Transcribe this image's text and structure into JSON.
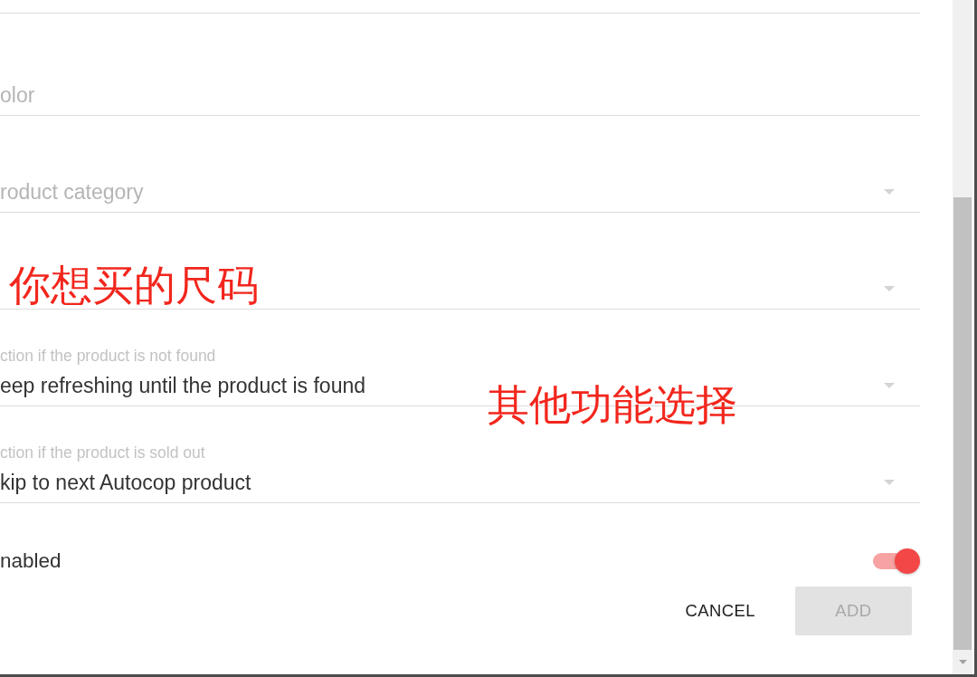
{
  "form": {
    "fields": [
      {
        "kind": "text"
      },
      {
        "kind": "text",
        "placeholder": "olor"
      },
      {
        "kind": "select",
        "placeholder": "roduct category"
      },
      {
        "kind": "select"
      },
      {
        "kind": "select",
        "label": "ction if the product is not found",
        "value": "eep refreshing until the product is found"
      },
      {
        "kind": "select",
        "label": "ction if the product is sold out",
        "value": "kip to next Autocop product"
      }
    ],
    "toggle": {
      "label": "nabled",
      "on": true
    },
    "buttons": [
      {
        "label": "CANCEL",
        "disabled": false
      },
      {
        "label": "ADD",
        "disabled": true
      }
    ]
  },
  "annotations": [
    {
      "text": "你想买的尺码"
    },
    {
      "text": "其他功能选择"
    }
  ]
}
